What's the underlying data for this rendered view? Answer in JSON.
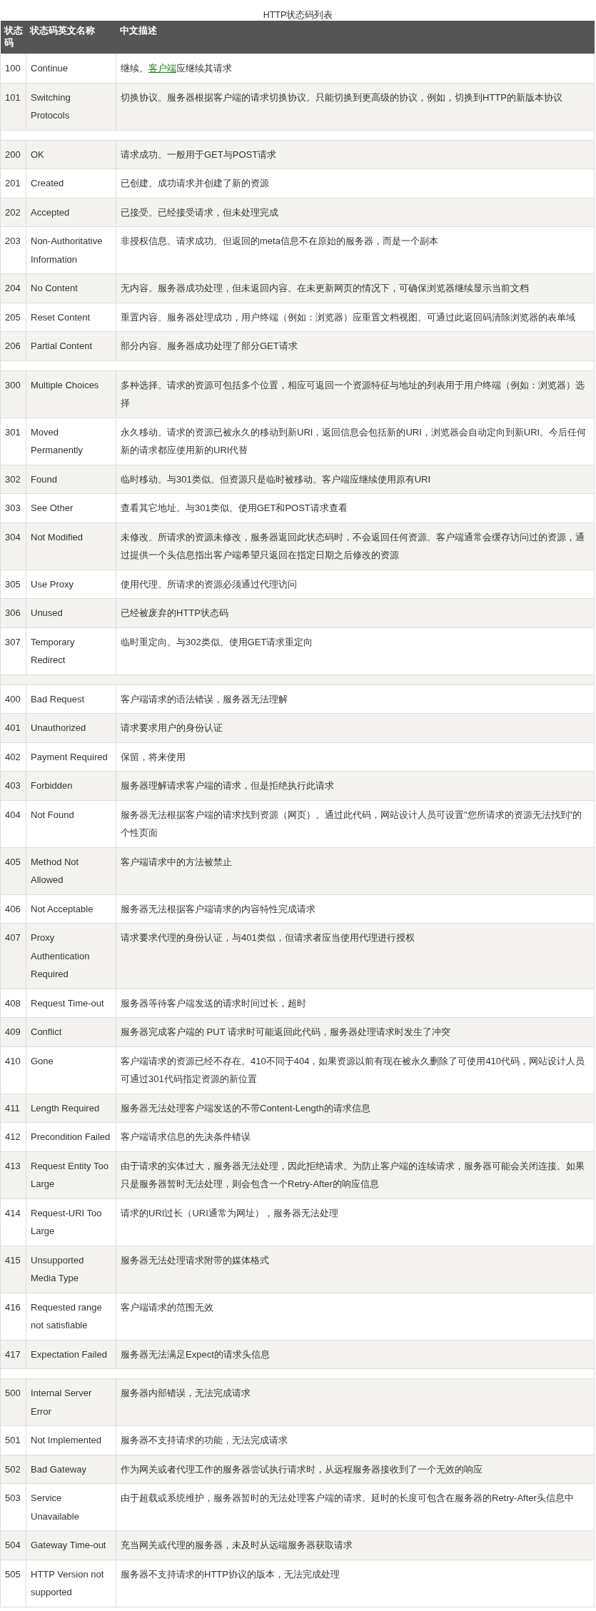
{
  "caption": "HTTP状态码列表",
  "columns": [
    "状态码",
    "状态码英文名称",
    "中文描述"
  ],
  "groups": [
    [
      {
        "code": "100",
        "name": "Continue",
        "description": [
          {
            "kind": "text",
            "text": "继续。"
          },
          {
            "kind": "link",
            "text": "客户端"
          },
          {
            "kind": "text",
            "text": "应继续其请求"
          }
        ]
      },
      {
        "code": "101",
        "name": "Switching Protocols",
        "description": "切换协议。服务器根据客户端的请求切换协议。只能切换到更高级的协议，例如，切换到HTTP的新版本协议"
      }
    ],
    [
      {
        "code": "200",
        "name": "OK",
        "description": "请求成功。一般用于GET与POST请求"
      },
      {
        "code": "201",
        "name": "Created",
        "description": "已创建。成功请求并创建了新的资源"
      },
      {
        "code": "202",
        "name": "Accepted",
        "description": "已接受。已经接受请求，但未处理完成"
      },
      {
        "code": "203",
        "name": "Non-Authoritative Information",
        "description": "非授权信息。请求成功。但返回的meta信息不在原始的服务器，而是一个副本"
      },
      {
        "code": "204",
        "name": "No Content",
        "description": "无内容。服务器成功处理，但未返回内容。在未更新网页的情况下，可确保浏览器继续显示当前文档"
      },
      {
        "code": "205",
        "name": "Reset Content",
        "description": "重置内容。服务器处理成功，用户终端（例如：浏览器）应重置文档视图。可通过此返回码清除浏览器的表单域"
      },
      {
        "code": "206",
        "name": "Partial Content",
        "description": "部分内容。服务器成功处理了部分GET请求"
      }
    ],
    [
      {
        "code": "300",
        "name": "Multiple Choices",
        "description": "多种选择。请求的资源可包括多个位置，相应可返回一个资源特征与地址的列表用于用户终端（例如：浏览器）选择"
      },
      {
        "code": "301",
        "name": "Moved Permanently",
        "description": "永久移动。请求的资源已被永久的移动到新URI，返回信息会包括新的URI，浏览器会自动定向到新URI。今后任何新的请求都应使用新的URI代替"
      },
      {
        "code": "302",
        "name": "Found",
        "description": "临时移动。与301类似。但资源只是临时被移动。客户端应继续使用原有URI"
      },
      {
        "code": "303",
        "name": "See Other",
        "description": "查看其它地址。与301类似。使用GET和POST请求查看"
      },
      {
        "code": "304",
        "name": "Not Modified",
        "description": "未修改。所请求的资源未修改，服务器返回此状态码时，不会返回任何资源。客户端通常会缓存访问过的资源，通过提供一个头信息指出客户端希望只返回在指定日期之后修改的资源"
      },
      {
        "code": "305",
        "name": "Use Proxy",
        "description": "使用代理。所请求的资源必须通过代理访问"
      },
      {
        "code": "306",
        "name": "Unused",
        "description": "已经被废弃的HTTP状态码"
      },
      {
        "code": "307",
        "name": "Temporary Redirect",
        "description": "临时重定向。与302类似。使用GET请求重定向"
      }
    ],
    [
      {
        "code": "400",
        "name": "Bad Request",
        "description": "客户端请求的语法错误，服务器无法理解"
      },
      {
        "code": "401",
        "name": "Unauthorized",
        "description": "请求要求用户的身份认证"
      },
      {
        "code": "402",
        "name": "Payment Required",
        "description": "保留，将来使用"
      },
      {
        "code": "403",
        "name": "Forbidden",
        "description": "服务器理解请求客户端的请求，但是拒绝执行此请求"
      },
      {
        "code": "404",
        "name": "Not Found",
        "description": "服务器无法根据客户端的请求找到资源（网页）。通过此代码，网站设计人员可设置\"您所请求的资源无法找到\"的个性页面"
      },
      {
        "code": "405",
        "name": "Method Not Allowed",
        "description": "客户端请求中的方法被禁止"
      },
      {
        "code": "406",
        "name": "Not Acceptable",
        "description": "服务器无法根据客户端请求的内容特性完成请求"
      },
      {
        "code": "407",
        "name": "Proxy Authentication Required",
        "description": "请求要求代理的身份认证，与401类似，但请求者应当使用代理进行授权"
      },
      {
        "code": "408",
        "name": "Request Time-out",
        "description": "服务器等待客户端发送的请求时间过长，超时"
      },
      {
        "code": "409",
        "name": "Conflict",
        "description": "服务器完成客户端的 PUT 请求时可能返回此代码，服务器处理请求时发生了冲突"
      },
      {
        "code": "410",
        "name": "Gone",
        "description": "客户端请求的资源已经不存在。410不同于404，如果资源以前有现在被永久删除了可使用410代码，网站设计人员可通过301代码指定资源的新位置"
      },
      {
        "code": "411",
        "name": "Length Required",
        "description": "服务器无法处理客户端发送的不带Content-Length的请求信息"
      },
      {
        "code": "412",
        "name": "Precondition Failed",
        "description": "客户端请求信息的先决条件错误"
      },
      {
        "code": "413",
        "name": "Request Entity Too Large",
        "description": "由于请求的实体过大，服务器无法处理，因此拒绝请求。为防止客户端的连续请求，服务器可能会关闭连接。如果只是服务器暂时无法处理，则会包含一个Retry-After的响应信息"
      },
      {
        "code": "414",
        "name": "Request-URI Too Large",
        "description": "请求的URI过长（URI通常为网址），服务器无法处理"
      },
      {
        "code": "415",
        "name": "Unsupported Media Type",
        "description": "服务器无法处理请求附带的媒体格式"
      },
      {
        "code": "416",
        "name": "Requested range not satisfiable",
        "description": "客户端请求的范围无效"
      },
      {
        "code": "417",
        "name": "Expectation Failed",
        "description": "服务器无法满足Expect的请求头信息"
      }
    ],
    [
      {
        "code": "500",
        "name": "Internal Server Error",
        "description": "服务器内部错误，无法完成请求"
      },
      {
        "code": "501",
        "name": "Not Implemented",
        "description": "服务器不支持请求的功能，无法完成请求"
      },
      {
        "code": "502",
        "name": "Bad Gateway",
        "description": "作为网关或者代理工作的服务器尝试执行请求时，从远程服务器接收到了一个无效的响应"
      },
      {
        "code": "503",
        "name": "Service Unavailable",
        "description": "由于超载或系统维护，服务器暂时的无法处理客户端的请求。延时的长度可包含在服务器的Retry-After头信息中"
      },
      {
        "code": "504",
        "name": "Gateway Time-out",
        "description": "充当网关或代理的服务器，未及时从远端服务器获取请求"
      },
      {
        "code": "505",
        "name": "HTTP Version not supported",
        "description": "服务器不支持请求的HTTP协议的版本，无法完成处理"
      }
    ]
  ]
}
